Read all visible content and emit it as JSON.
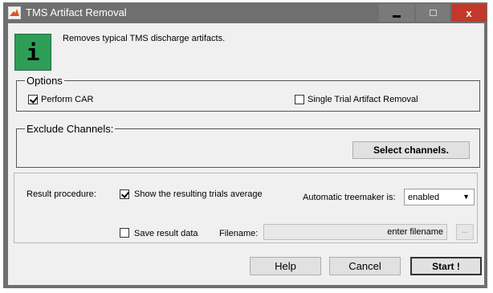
{
  "window": {
    "title": "TMS Artifact Removal",
    "close_label": "x"
  },
  "info": {
    "icon_glyph": "i",
    "description": "Removes typical TMS discharge artifacts."
  },
  "options": {
    "legend": "Options",
    "perform_car": {
      "label": "Perform CAR",
      "checked": true
    },
    "single_trial": {
      "label": "Single Trial Artifact Removal",
      "checked": false
    }
  },
  "exclude": {
    "legend": "Exclude Channels:",
    "select_button": "Select channels."
  },
  "result": {
    "procedure_label": "Result procedure:",
    "show_average": {
      "label": "Show the resulting trials average",
      "checked": true
    },
    "treemaker_label": "Automatic treemaker is:",
    "treemaker_value": "enabled",
    "save_data": {
      "label": "Save result data",
      "checked": false
    },
    "filename_label": "Filename:",
    "filename_value": "enter filename",
    "browse_label": "..."
  },
  "actions": {
    "help": "Help",
    "cancel": "Cancel",
    "start": "Start !"
  }
}
